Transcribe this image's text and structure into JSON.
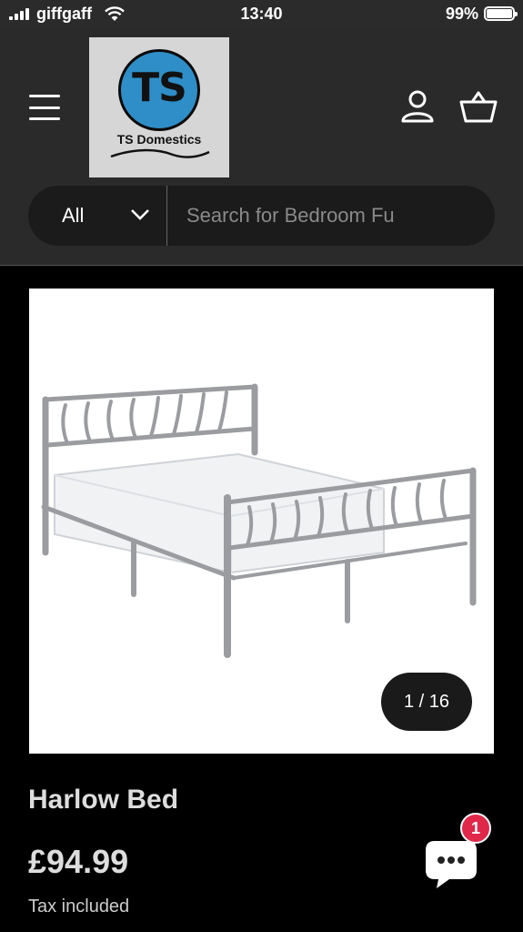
{
  "status_bar": {
    "carrier": "giffgaff",
    "time": "13:40",
    "battery": "99%"
  },
  "header": {
    "logo": {
      "monogram": "TS",
      "name": "TS Domestics"
    },
    "icons": {
      "menu": "hamburger-icon",
      "account": "user-icon",
      "cart": "basket-icon"
    }
  },
  "search": {
    "category": "All",
    "placeholder": "Search for Bedroom Fu"
  },
  "product": {
    "image_counter": "1 / 16",
    "title": "Harlow Bed",
    "price": "£94.99",
    "tax_note": "Tax included"
  },
  "chat": {
    "badge_count": "1"
  },
  "colors": {
    "header_bg": "#2a2a2a",
    "page_bg": "#000000",
    "logo_circle": "#2f8ec7",
    "badge": "#e0284a"
  }
}
